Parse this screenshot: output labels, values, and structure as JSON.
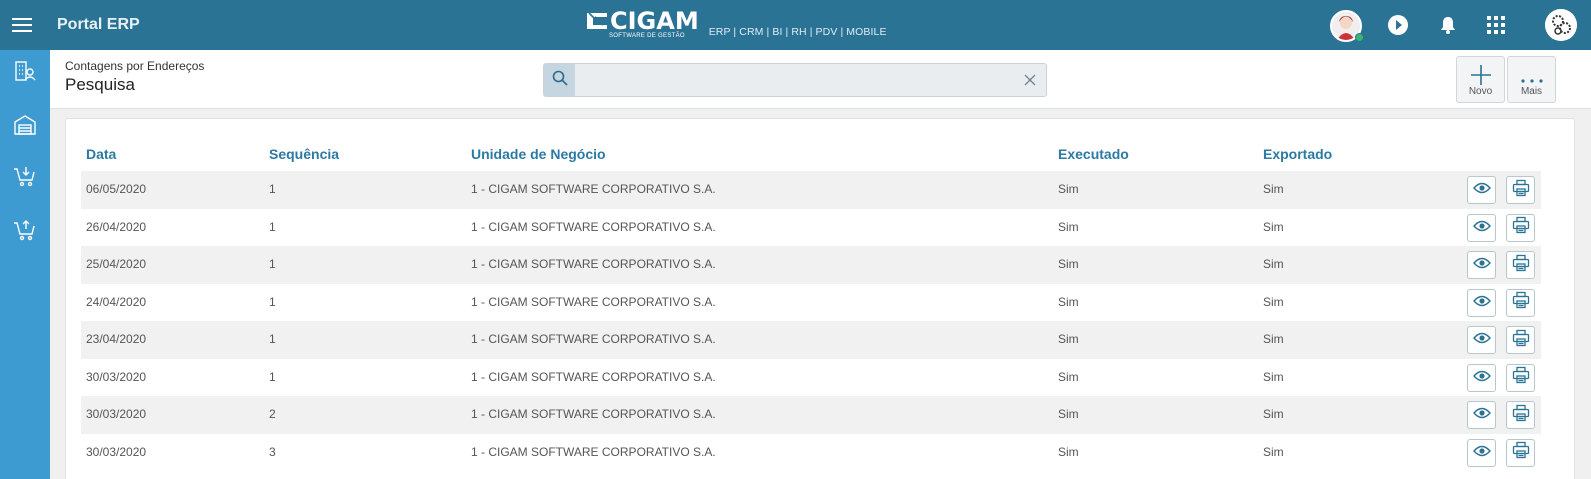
{
  "topbar": {
    "app_title": "Portal ERP",
    "brand_name": "CIGAM",
    "brand_tagline": "SOFTWARE DE GESTÃO",
    "brand_products": "ERP | CRM | BI | RH | PDV | MOBILE",
    "icons": [
      "menu-icon",
      "user-avatar",
      "play-icon",
      "bell-icon",
      "apps-grid-icon",
      "company-logo"
    ]
  },
  "sidebar": {
    "items": [
      {
        "icon": "contacts-building-icon"
      },
      {
        "icon": "warehouse-icon"
      },
      {
        "icon": "cart-download-icon"
      },
      {
        "icon": "cart-upload-icon"
      }
    ]
  },
  "header": {
    "breadcrumb": "Contagens por Endereços",
    "title": "Pesquisa",
    "search": {
      "value": "",
      "placeholder": ""
    },
    "buttons": {
      "new_label": "Novo",
      "more_label": "Mais"
    }
  },
  "table": {
    "columns": {
      "date": "Data",
      "sequence": "Sequência",
      "business_unit": "Unidade de Negócio",
      "executed": "Executado",
      "exported": "Exportado"
    },
    "rows": [
      {
        "date": "06/05/2020",
        "sequence": "1",
        "business_unit": "1 - CIGAM SOFTWARE CORPORATIVO S.A.",
        "executed": "Sim",
        "exported": "Sim"
      },
      {
        "date": "26/04/2020",
        "sequence": "1",
        "business_unit": "1 - CIGAM SOFTWARE CORPORATIVO S.A.",
        "executed": "Sim",
        "exported": "Sim"
      },
      {
        "date": "25/04/2020",
        "sequence": "1",
        "business_unit": "1 - CIGAM SOFTWARE CORPORATIVO S.A.",
        "executed": "Sim",
        "exported": "Sim"
      },
      {
        "date": "24/04/2020",
        "sequence": "1",
        "business_unit": "1 - CIGAM SOFTWARE CORPORATIVO S.A.",
        "executed": "Sim",
        "exported": "Sim"
      },
      {
        "date": "23/04/2020",
        "sequence": "1",
        "business_unit": "1 - CIGAM SOFTWARE CORPORATIVO S.A.",
        "executed": "Sim",
        "exported": "Sim"
      },
      {
        "date": "30/03/2020",
        "sequence": "1",
        "business_unit": "1 - CIGAM SOFTWARE CORPORATIVO S.A.",
        "executed": "Sim",
        "exported": "Sim"
      },
      {
        "date": "30/03/2020",
        "sequence": "2",
        "business_unit": "1 - CIGAM SOFTWARE CORPORATIVO S.A.",
        "executed": "Sim",
        "exported": "Sim"
      },
      {
        "date": "30/03/2020",
        "sequence": "3",
        "business_unit": "1 - CIGAM SOFTWARE CORPORATIVO S.A.",
        "executed": "Sim",
        "exported": "Sim"
      }
    ],
    "row_actions": [
      "eye-icon",
      "printer-icon"
    ]
  },
  "colors": {
    "topbar": "#2b7395",
    "sidebar": "#3d9bd1",
    "header_text": "#2b7aa4",
    "online_status": "#3cb371"
  }
}
